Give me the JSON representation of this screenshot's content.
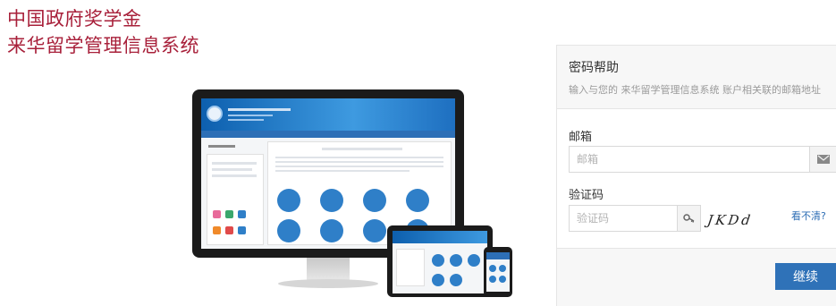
{
  "header": {
    "title_line1": "中国政府奖学金",
    "title_line2": "来华留学管理信息系统"
  },
  "panel": {
    "title": "密码帮助",
    "subtitle": "输入与您的 来华留学管理信息系统 账户相关联的邮箱地址",
    "email_label": "邮箱",
    "email_placeholder": "邮箱",
    "email_icon": "envelope-icon",
    "captcha_label": "验证码",
    "captcha_placeholder": "验证码",
    "captcha_icon": "key-icon",
    "captcha_text": "JKDd",
    "captcha_refresh_link": "看不清?",
    "continue_button": "继续"
  },
  "colors": {
    "title_red": "#a8203a",
    "button_blue": "#2f72b8",
    "link_blue": "#2e6eb5"
  }
}
